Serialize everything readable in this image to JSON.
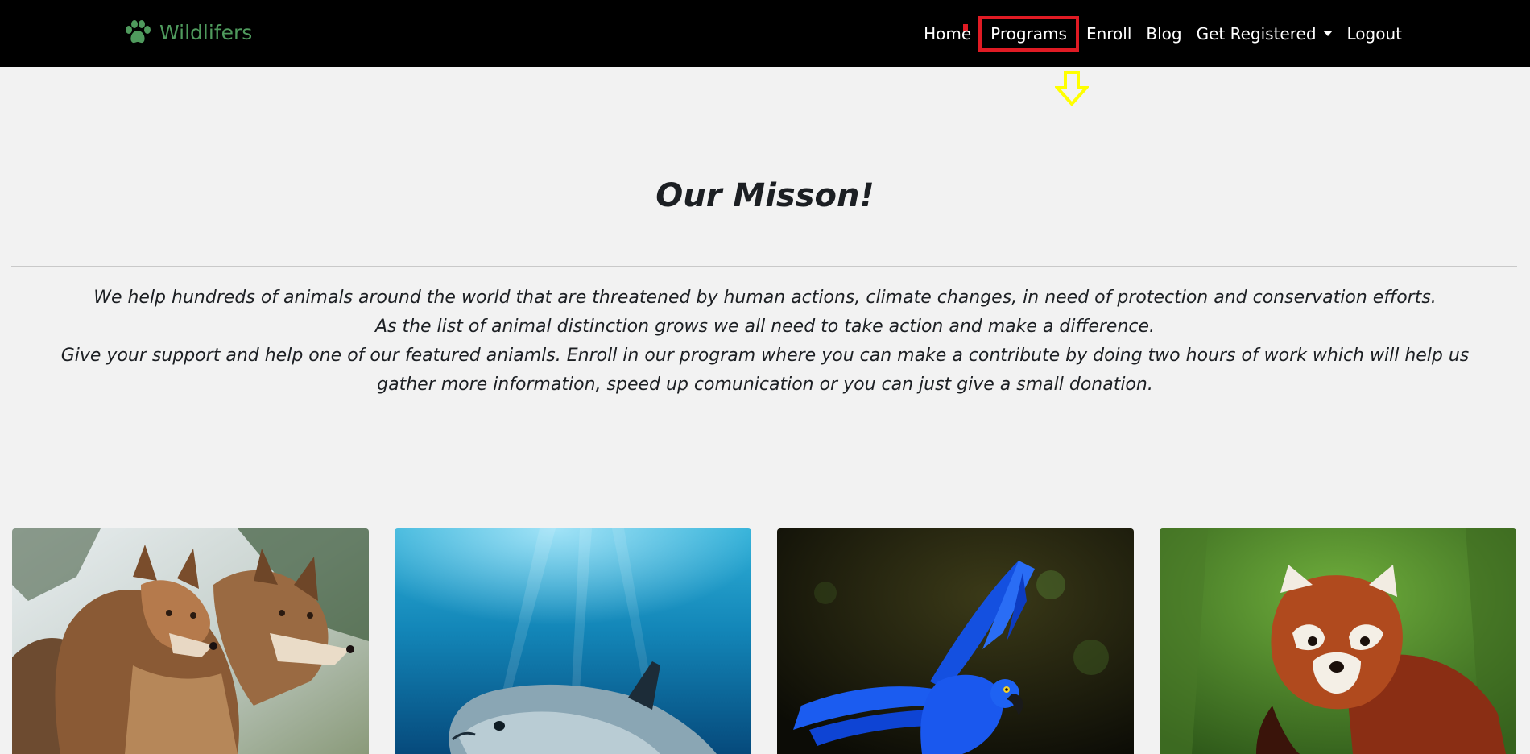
{
  "brand": {
    "name": "Wildlifers",
    "icon": "paw-icon",
    "color": "#4f9a5d"
  },
  "nav": {
    "items": [
      {
        "label": "Home"
      },
      {
        "label": "Programs"
      },
      {
        "label": "Enroll"
      },
      {
        "label": "Blog"
      },
      {
        "label": "Get Registered"
      },
      {
        "label": "Logout"
      }
    ]
  },
  "annotation": {
    "highlight_color": "#e01b24",
    "arrow_color": "#ffff00",
    "arrow_icon": "down-arrow-icon"
  },
  "mission": {
    "title": "Our Misson!",
    "lines": [
      "We help hundreds of animals around the world that are threatened by human actions, climate changes, in need of protection and conservation efforts.",
      "As the list of animal distinction grows we all need to take action and make a difference.",
      "Give your support and help one of our featured aniamls. Enroll in our program where you can make a contribute by doing two hours of work which will help us gather more information, speed up comunication or you can just give a small donation."
    ]
  },
  "cards": [
    {
      "image": "red-wolves-image"
    },
    {
      "image": "vaquita-porpoise-image"
    },
    {
      "image": "blue-macaw-image"
    },
    {
      "image": "red-panda-image"
    }
  ]
}
